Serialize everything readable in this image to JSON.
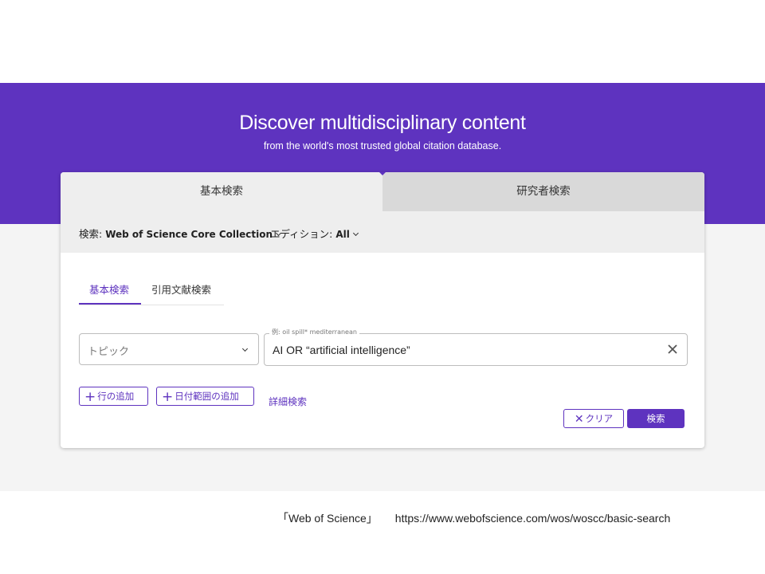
{
  "hero": {
    "title": "Discover multidisciplinary content",
    "subtitle": "from the world's most trusted global citation database."
  },
  "top_tabs": [
    {
      "label": "基本検索",
      "active": true
    },
    {
      "label": "研究者検索",
      "active": false
    }
  ],
  "collection": {
    "search_label": "検索:",
    "search_value": "Web of Science Core Collection",
    "edition_label": "エディション:",
    "edition_value": "All"
  },
  "sub_tabs": [
    {
      "label": "基本検索",
      "active": true
    },
    {
      "label": "引用文献検索",
      "active": false
    }
  ],
  "field_select": {
    "placeholder": "トピック"
  },
  "query": {
    "legend": "例: oil spill* mediterranean",
    "value": "AI OR “artificial intelligence”"
  },
  "buttons": {
    "add_row": "行の追加",
    "add_date_range": "日付範囲の追加",
    "advanced": "詳細検索",
    "clear": "クリア",
    "search": "検索",
    "plus_glyph": "+",
    "x_glyph": "✕"
  },
  "caption": {
    "source": "「Web of Science」",
    "url": "https://www.webofscience.com/wos/woscc/basic-search"
  },
  "colors": {
    "brand_purple": "#5e33bf",
    "tab_active_bg": "#eeeeee",
    "tab_inactive_bg": "#d9d9d9",
    "page_gray": "#f4f4f4"
  },
  "icons": [
    "chevron-down-icon",
    "close-icon",
    "plus-icon"
  ]
}
